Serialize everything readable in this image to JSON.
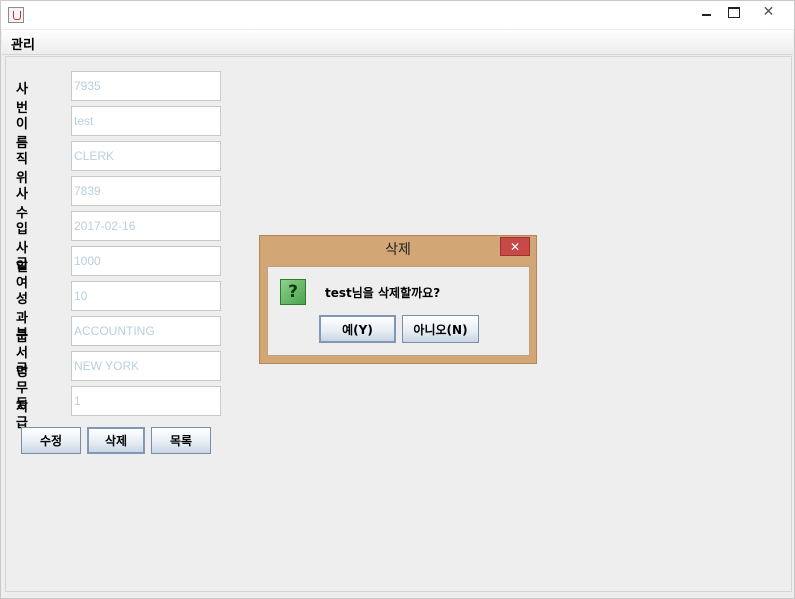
{
  "window": {
    "icon": "java-cup-icon",
    "controls": {
      "minimize": "",
      "maximize": "",
      "close": "✕"
    }
  },
  "menu": {
    "items": [
      "관리"
    ]
  },
  "form": {
    "fields": [
      {
        "label": "사번",
        "value": "7935"
      },
      {
        "label": "이름",
        "value": "test"
      },
      {
        "label": "직위",
        "value": "CLERK"
      },
      {
        "label": "사수",
        "value": "7839"
      },
      {
        "label": "입사일",
        "value": "2017-02-16"
      },
      {
        "label": "급여",
        "value": "1000"
      },
      {
        "label": "성과급",
        "value": "10"
      },
      {
        "label": "부서명",
        "value": "ACCOUNTING"
      },
      {
        "label": "근무지",
        "value": "NEW YORK"
      },
      {
        "label": "등급",
        "value": "1"
      }
    ],
    "buttons": {
      "edit": "수정",
      "delete": "삭제",
      "list": "목록"
    }
  },
  "dialog": {
    "title": "삭제",
    "close": "✕",
    "icon": "question-icon",
    "icon_glyph": "?",
    "message": "test님을 삭제할까요?",
    "yes": "예(Y)",
    "no": "아니오(N)"
  }
}
